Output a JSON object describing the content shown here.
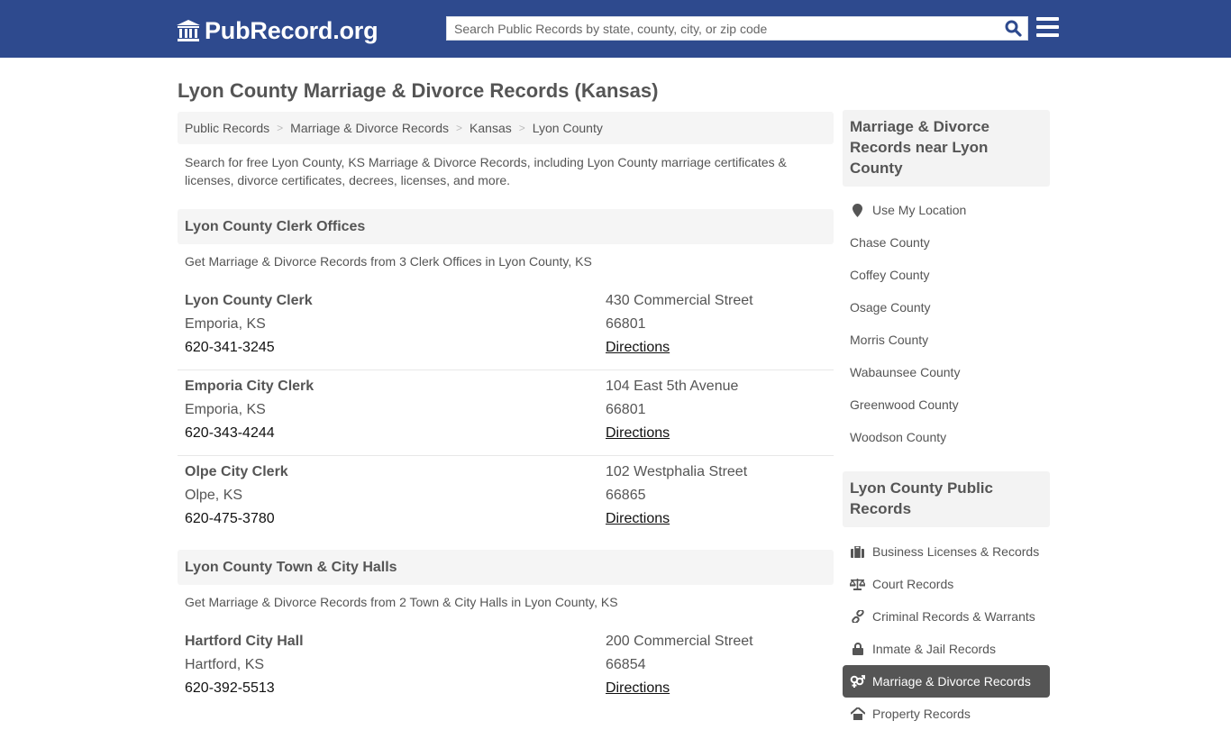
{
  "header": {
    "logo_text": "PubRecord.org",
    "search_placeholder": "Search Public Records by state, county, city, or zip code",
    "search_value": ""
  },
  "page": {
    "title": "Lyon County Marriage & Divorce Records (Kansas)",
    "breadcrumb": [
      "Public Records",
      "Marriage & Divorce Records",
      "Kansas",
      "Lyon County"
    ],
    "intro": "Search for free Lyon County, KS Marriage & Divorce Records, including Lyon County marriage certificates & licenses, divorce certificates, decrees, licenses, and more."
  },
  "sections": [
    {
      "title": "Lyon County Clerk Offices",
      "subtitle": "Get Marriage & Divorce Records from 3 Clerk Offices in Lyon County, KS",
      "offices": [
        {
          "name": "Lyon County Clerk",
          "city": "Emporia, KS",
          "phone": "620-341-3245",
          "address": "430 Commercial Street",
          "zip": "66801",
          "link": "Directions"
        },
        {
          "name": "Emporia City Clerk",
          "city": "Emporia, KS",
          "phone": "620-343-4244",
          "address": "104 East 5th Avenue",
          "zip": "66801",
          "link": "Directions"
        },
        {
          "name": "Olpe City Clerk",
          "city": "Olpe, KS",
          "phone": "620-475-3780",
          "address": "102 Westphalia Street",
          "zip": "66865",
          "link": "Directions"
        }
      ]
    },
    {
      "title": "Lyon County Town & City Halls",
      "subtitle": "Get Marriage & Divorce Records from 2 Town & City Halls in Lyon County, KS",
      "offices": [
        {
          "name": "Hartford City Hall",
          "city": "Hartford, KS",
          "phone": "620-392-5513",
          "address": "200 Commercial Street",
          "zip": "66854",
          "link": "Directions"
        }
      ]
    }
  ],
  "sidebar": {
    "nearby_title": "Marriage & Divorce Records near Lyon County",
    "use_location": "Use My Location",
    "nearby": [
      "Chase County",
      "Coffey County",
      "Osage County",
      "Morris County",
      "Wabaunsee County",
      "Greenwood County",
      "Woodson County"
    ],
    "public_title": "Lyon County Public Records",
    "public_records": [
      {
        "label": "Business Licenses & Records",
        "icon": "briefcase-icon"
      },
      {
        "label": "Court Records",
        "icon": "scale-icon"
      },
      {
        "label": "Criminal Records & Warrants",
        "icon": "link-icon"
      },
      {
        "label": "Inmate & Jail Records",
        "icon": "lock-icon"
      },
      {
        "label": "Marriage & Divorce Records",
        "icon": "gender-icon",
        "active": true
      },
      {
        "label": "Property Records",
        "icon": "home-icon"
      }
    ]
  },
  "colors": {
    "brand": "#2e4a8e",
    "active_item": "#555555",
    "search_icon": "#2e4a8e"
  }
}
